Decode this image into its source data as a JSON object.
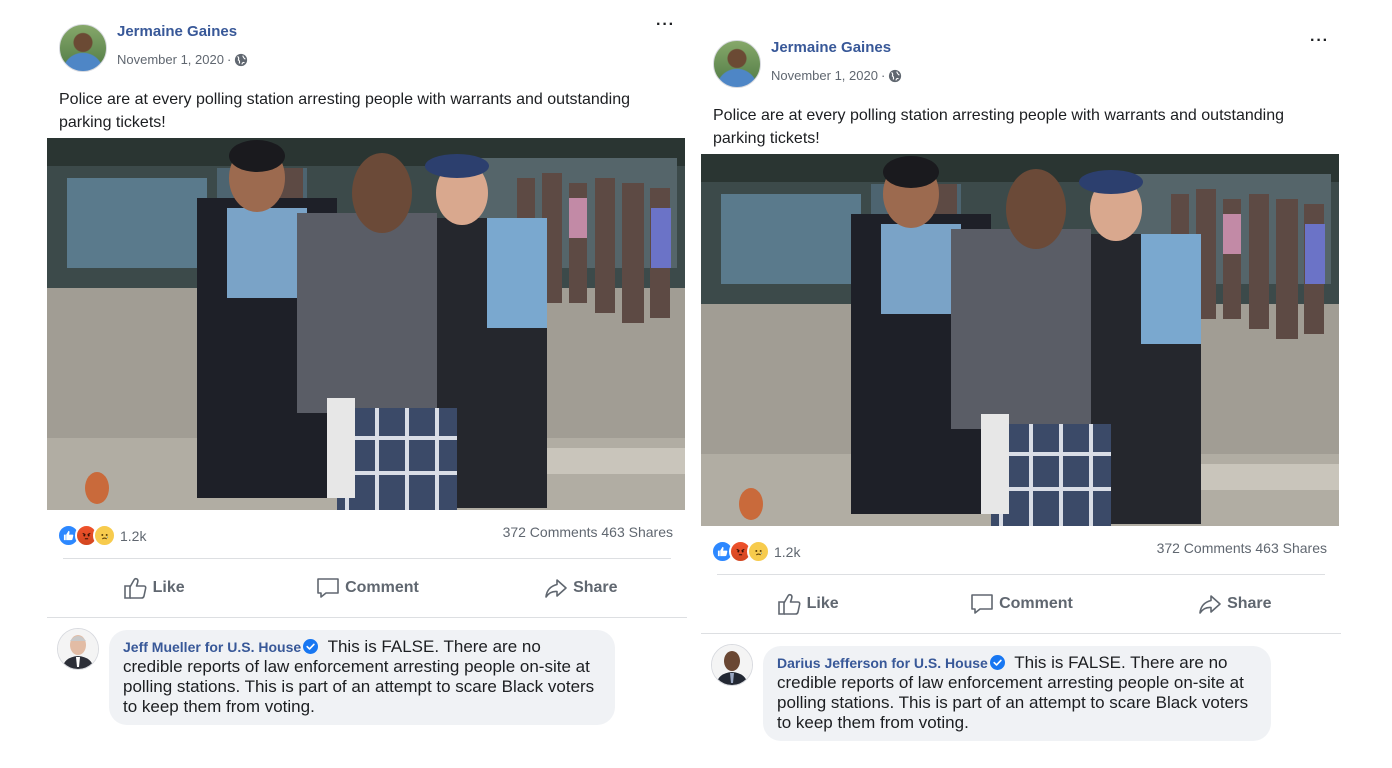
{
  "posts": [
    {
      "author": "Jermaine Gaines",
      "date": "November 1, 2020",
      "date_separator": "·",
      "more_label": "···",
      "text": "Police are at every polling station arresting people with warrants and outstanding parking tickets!",
      "reaction_count": "1.2k",
      "stats": "372 Comments 463 Shares",
      "actions": {
        "like": "Like",
        "comment": "Comment",
        "share": "Share"
      },
      "comment": {
        "author": "Jeff Mueller for U.S. House",
        "text": "This is FALSE. There are no credible reports of law enforcement arresting people on-site at polling stations. This is part of an attempt to scare Black voters to keep them from voting."
      }
    },
    {
      "author": "Jermaine Gaines",
      "date": "November 1, 2020",
      "date_separator": "·",
      "more_label": "···",
      "text": "Police are at every polling station arresting people with warrants and outstanding parking tickets!",
      "reaction_count": "1.2k",
      "stats": "372 Comments 463 Shares",
      "actions": {
        "like": "Like",
        "comment": "Comment",
        "share": "Share"
      },
      "comment": {
        "author": "Darius Jefferson for U.S. House",
        "text": "This is FALSE. There are no credible reports of law enforcement arresting people on-site at polling stations. This is part of an attempt to scare Black voters to keep them from voting."
      }
    }
  ],
  "icons": [
    "globe-icon",
    "more-icon",
    "like-reaction-icon",
    "angry-reaction-icon",
    "sad-reaction-icon",
    "thumbs-up-icon",
    "comment-icon",
    "share-icon",
    "verified-badge-icon"
  ],
  "colors": {
    "link": "#385898",
    "secondary_text": "#606770",
    "bubble": "#f0f2f5",
    "like_blue": "#2d88ff"
  }
}
